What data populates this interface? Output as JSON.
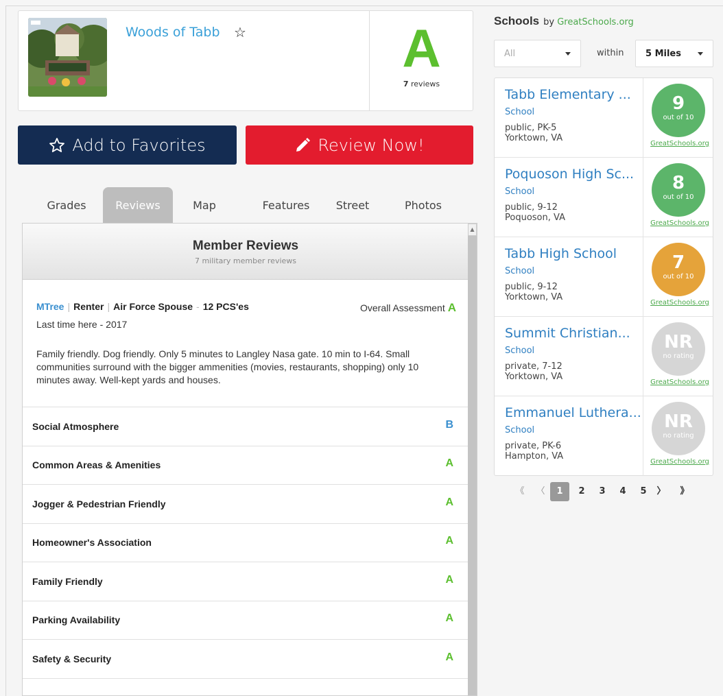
{
  "property": {
    "name": "Woods of Tabb",
    "grade": "A",
    "review_count": "7",
    "review_count_suffix": " reviews"
  },
  "buttons": {
    "favorites": "Add to Favorites",
    "review": "Review Now!"
  },
  "tabs": [
    {
      "label": "Grades"
    },
    {
      "label": "Reviews"
    },
    {
      "label": "Map"
    },
    {
      "label": "Features"
    },
    {
      "label": "Street"
    },
    {
      "label": "Photos"
    }
  ],
  "reviews": {
    "title": "Member Reviews",
    "subtitle": "7 military member reviews",
    "review": {
      "user": "MTree",
      "tenure": "Renter",
      "role": "Air Force Spouse",
      "pcs": "12 PCS'es",
      "overall_label": "Overall Assessment",
      "overall_grade": "A",
      "last_time": "Last time here - 2017",
      "text": "Family friendly. Dog friendly. Only 5 minutes to Langley Nasa gate. 10 min to I-64. Small communities surround with the bigger ammenities (movies, restaurants, shopping) only 10 minutes away. Well-kept yards and houses."
    },
    "categories": [
      {
        "label": "Social Atmosphere",
        "grade": "B",
        "color": "#3a8fcf"
      },
      {
        "label": "Common Areas & Amenities",
        "grade": "A",
        "color": "#5cbf2f"
      },
      {
        "label": "Jogger & Pedestrian Friendly",
        "grade": "A",
        "color": "#5cbf2f"
      },
      {
        "label": "Homeowner's Association",
        "grade": "A",
        "color": "#5cbf2f"
      },
      {
        "label": "Family Friendly",
        "grade": "A",
        "color": "#5cbf2f"
      },
      {
        "label": "Parking Availability",
        "grade": "A",
        "color": "#5cbf2f"
      },
      {
        "label": "Safety & Security",
        "grade": "A",
        "color": "#5cbf2f"
      }
    ]
  },
  "schools": {
    "title": "Schools",
    "by": "by ",
    "source": "GreatSchools.org",
    "filter_all": "All",
    "within": "within",
    "distance": "5 Miles",
    "list": [
      {
        "name": "Tabb Elementary ...",
        "type": "School",
        "level": "public, PK-5",
        "city": "Yorktown, VA",
        "rating": "9",
        "rating_sub": "out of 10",
        "color": "#5cb56a",
        "link": "GreatSchools.org"
      },
      {
        "name": "Poquoson High Sc...",
        "type": "School",
        "level": "public, 9-12",
        "city": "Poquoson, VA",
        "rating": "8",
        "rating_sub": "out of 10",
        "color": "#5cb56a",
        "link": "GreatSchools.org"
      },
      {
        "name": "Tabb High School",
        "type": "School",
        "level": "public, 9-12",
        "city": "Yorktown, VA",
        "rating": "7",
        "rating_sub": "out of 10",
        "color": "#e5a33a",
        "link": "GreatSchools.org"
      },
      {
        "name": "Summit Christian...",
        "type": "School",
        "level": "private, 7-12",
        "city": "Yorktown, VA",
        "rating": "NR",
        "rating_sub": "no rating",
        "color": "#d6d6d6",
        "link": "GreatSchools.org"
      },
      {
        "name": "Emmanuel Luthera...",
        "type": "School",
        "level": "private, PK-6",
        "city": "Hampton, VA",
        "rating": "NR",
        "rating_sub": "no rating",
        "color": "#d6d6d6",
        "link": "GreatSchools.org"
      }
    ],
    "pager": {
      "first": "《",
      "prev": "〈",
      "pages": [
        "1",
        "2",
        "3",
        "4",
        "5"
      ],
      "current": "1",
      "next": "〉",
      "last": "》"
    }
  }
}
